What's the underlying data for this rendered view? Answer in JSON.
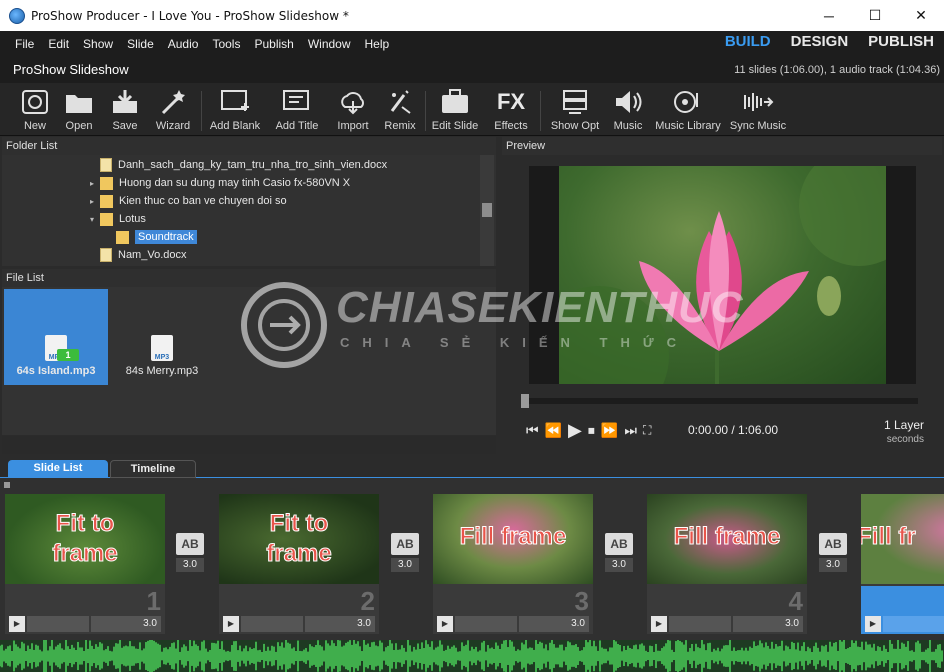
{
  "window": {
    "title": "ProShow Producer - I Love You - ProShow Slideshow *",
    "controls": [
      "─",
      "☐",
      "✕"
    ]
  },
  "menu": [
    "File",
    "Edit",
    "Show",
    "Slide",
    "Audio",
    "Tools",
    "Publish",
    "Window",
    "Help"
  ],
  "modes": [
    "BUILD",
    "DESIGN",
    "PUBLISH"
  ],
  "show": {
    "title": "ProShow Slideshow",
    "info": "11 slides (1:06.00), 1 audio track (1:04.36)"
  },
  "toolbar": [
    {
      "label": "New",
      "icon": "new-show-icon"
    },
    {
      "label": "Open",
      "icon": "open-folder-icon"
    },
    {
      "label": "Save",
      "icon": "save-icon"
    },
    {
      "label": "Wizard",
      "icon": "wizard-wand-icon"
    },
    {
      "label": "Add Blank",
      "icon": "add-blank-icon"
    },
    {
      "label": "Add Title",
      "icon": "add-title-icon"
    },
    {
      "label": "Import",
      "icon": "import-cloud-icon"
    },
    {
      "label": "Remix",
      "icon": "remix-icon"
    },
    {
      "label": "Edit Slide",
      "icon": "edit-slide-icon"
    },
    {
      "label": "Effects",
      "icon": "fx-icon"
    },
    {
      "label": "Show Opt",
      "icon": "show-options-icon"
    },
    {
      "label": "Music",
      "icon": "speaker-icon"
    },
    {
      "label": "Music Library",
      "icon": "music-library-icon"
    },
    {
      "label": "Sync Music",
      "icon": "sync-music-icon"
    }
  ],
  "folder_list": {
    "header": "Folder List",
    "rows": [
      {
        "label": "Danh_sach_dang_ky_tam_tru_nha_tro_sinh_vien.docx",
        "type": "doc"
      },
      {
        "label": "Huong dan su dung may tinh Casio fx-580VN X",
        "type": "folder",
        "arrow": "▸"
      },
      {
        "label": "Kien thuc co ban ve chuyen doi so",
        "type": "folder",
        "arrow": "▸"
      },
      {
        "label": "Lotus",
        "type": "folder",
        "arrow": "▾"
      },
      {
        "label": "Soundtrack",
        "type": "folder-selected"
      },
      {
        "label": "Nam_Vo.docx",
        "type": "doc"
      }
    ]
  },
  "file_list": {
    "header": "File List",
    "files": [
      {
        "name": "64s Island.mp3",
        "badge": "1",
        "selected": true
      },
      {
        "name": "84s Merry.mp3",
        "selected": false
      }
    ]
  },
  "preview": {
    "header": "Preview",
    "time": "0:00.00 / 1:06.00",
    "layers": "1 Layer",
    "seconds": "seconds"
  },
  "watermark": {
    "main": "CHIASEKIENTHUC",
    "sub": "CHIA SẺ KIẾN THỨC"
  },
  "tabs": [
    "Slide List",
    "Timeline"
  ],
  "slides": [
    {
      "number": "1",
      "text": [
        "Fit to",
        "frame"
      ],
      "duration": "3.0",
      "transition": "3.0"
    },
    {
      "number": "2",
      "text": [
        "Fit to",
        "frame"
      ],
      "duration": "3.0",
      "transition": "3.0"
    },
    {
      "number": "3",
      "text": [
        "Fill frame"
      ],
      "duration": "3.0",
      "transition": "3.0"
    },
    {
      "number": "4",
      "text": [
        "Fill frame"
      ],
      "duration": "3.0",
      "transition": "3.0"
    },
    {
      "number": "",
      "text": [
        "Fill fr"
      ],
      "duration": "",
      "transition": ""
    }
  ],
  "colors": {
    "accent": "#3a9bf0",
    "waveform": "#4bd45a",
    "slide_title": "#e8544a"
  }
}
